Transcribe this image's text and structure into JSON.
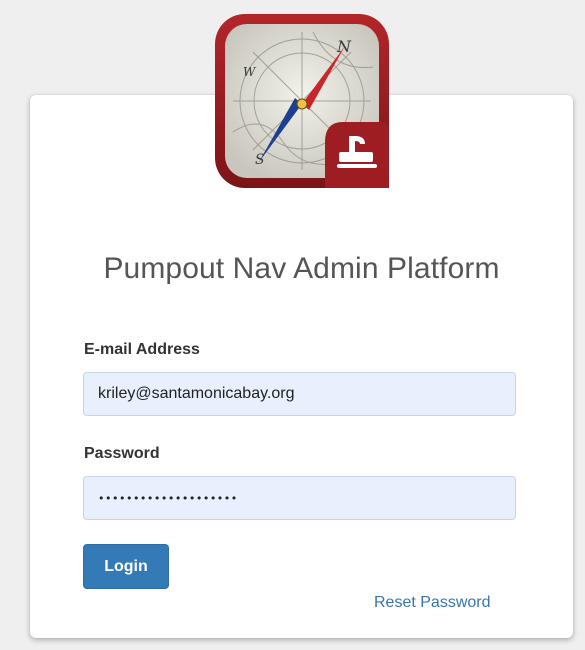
{
  "app": {
    "title": "Pumpout Nav Admin Platform",
    "logo_icon": "compass-pumpout-icon"
  },
  "form": {
    "email_label": "E-mail Address",
    "email_value": "kriley@santamonicabay.org",
    "password_label": "Password",
    "password_value": "••••••••••••••••••••",
    "login_label": "Login",
    "reset_label": "Reset Password"
  },
  "colors": {
    "primary": "#337ab7",
    "link": "#3874b0",
    "autofill": "#e8f0fe",
    "logo_red": "#a52a2a"
  }
}
